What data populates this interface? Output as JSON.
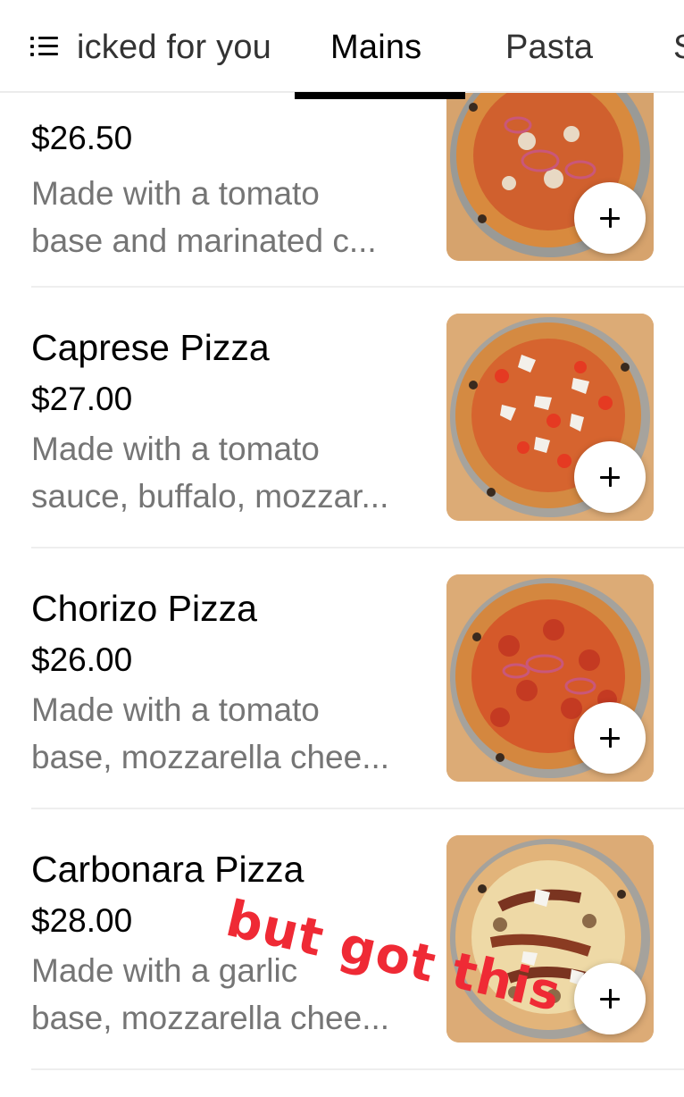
{
  "tabs": {
    "items": [
      {
        "label": "Picked for you",
        "active": false
      },
      {
        "label": "Mains",
        "active": true
      },
      {
        "label": "Pasta",
        "active": false
      },
      {
        "label": "S",
        "active": false
      }
    ]
  },
  "menu_items": [
    {
      "name": "",
      "price": "$26.50",
      "description_lines": [
        "Made with a tomato",
        "base and marinated c..."
      ]
    },
    {
      "name": "Caprese Pizza",
      "price": "$27.00",
      "description_lines": [
        "Made with a tomato",
        "sauce, buffalo, mozzar..."
      ]
    },
    {
      "name": "Chorizo Pizza",
      "price": "$26.00",
      "description_lines": [
        "Made with a tomato",
        "base, mozzarella chee..."
      ]
    },
    {
      "name": "Carbonara Pizza",
      "price": "$28.00",
      "description_lines": [
        "Made with a garlic",
        "base, mozzarella chee..."
      ]
    }
  ],
  "annotation": {
    "text": "but got this",
    "color": "#ef2a35"
  },
  "icons": {
    "menu": "list-menu-icon",
    "add": "plus-icon"
  }
}
